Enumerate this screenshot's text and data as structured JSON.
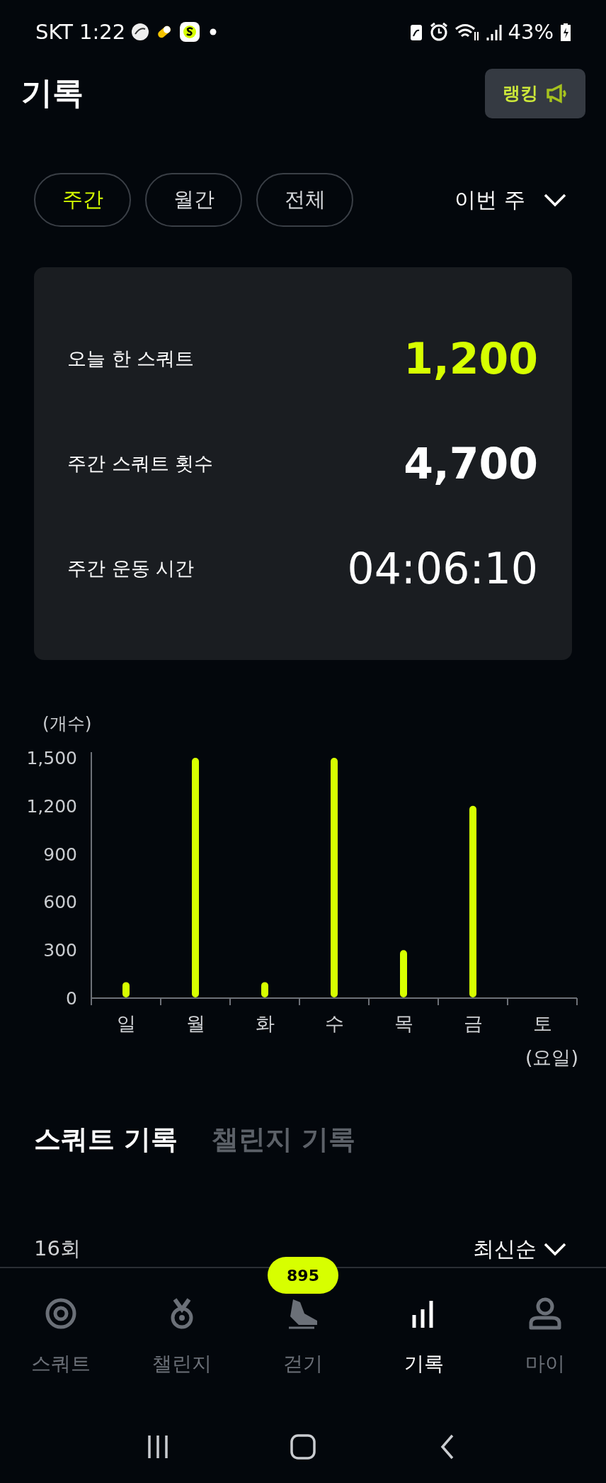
{
  "status_bar": {
    "carrier_time": "SKT 1:22",
    "battery": "43%"
  },
  "header": {
    "title": "기록",
    "ranking_button": "랭킹"
  },
  "period_tabs": [
    {
      "label": "주간",
      "selected": true
    },
    {
      "label": "월간",
      "selected": false
    },
    {
      "label": "전체",
      "selected": false
    }
  ],
  "period_select": {
    "value": "이번 주"
  },
  "summary": [
    {
      "label": "오늘 한 스쿼트",
      "value": "1,200",
      "kind": "highlight"
    },
    {
      "label": "주간 스쿼트 횟수",
      "value": "4,700",
      "kind": "bold"
    },
    {
      "label": "주간 운동 시간",
      "value": "04:06:10",
      "kind": "light"
    }
  ],
  "chart": {
    "chart_data": {
      "type": "bar",
      "ylabel": "(개수)",
      "xlabel": "(요일)",
      "categories": [
        "일",
        "월",
        "화",
        "수",
        "목",
        "금",
        "토"
      ],
      "values": [
        100,
        1500,
        100,
        1500,
        300,
        1200,
        null
      ],
      "ylim": [
        0,
        1500
      ],
      "yticks": [
        0,
        {
          "value": 300,
          "label": "300"
        },
        {
          "value": 600,
          "label": "600"
        },
        {
          "value": 900,
          "label": "900"
        },
        {
          "value": 1200,
          "label": "1,200"
        },
        {
          "value": 1500,
          "label": "1,500"
        }
      ]
    }
  },
  "record_tabs": [
    {
      "label": "스쿼트 기록",
      "selected": true
    },
    {
      "label": "챌린지 기록",
      "selected": false
    }
  ],
  "record_list": {
    "count": "16회",
    "sort": "최신순"
  },
  "bottom_nav": {
    "badge": "895",
    "items": [
      {
        "label": "스쿼트",
        "kind": "target",
        "selected": false
      },
      {
        "label": "챌린지",
        "kind": "medal",
        "selected": false
      },
      {
        "label": "걷기",
        "kind": "shoe",
        "selected": false
      },
      {
        "label": "기록",
        "kind": "bars",
        "selected": true
      },
      {
        "label": "마이",
        "kind": "person",
        "selected": false
      }
    ]
  }
}
